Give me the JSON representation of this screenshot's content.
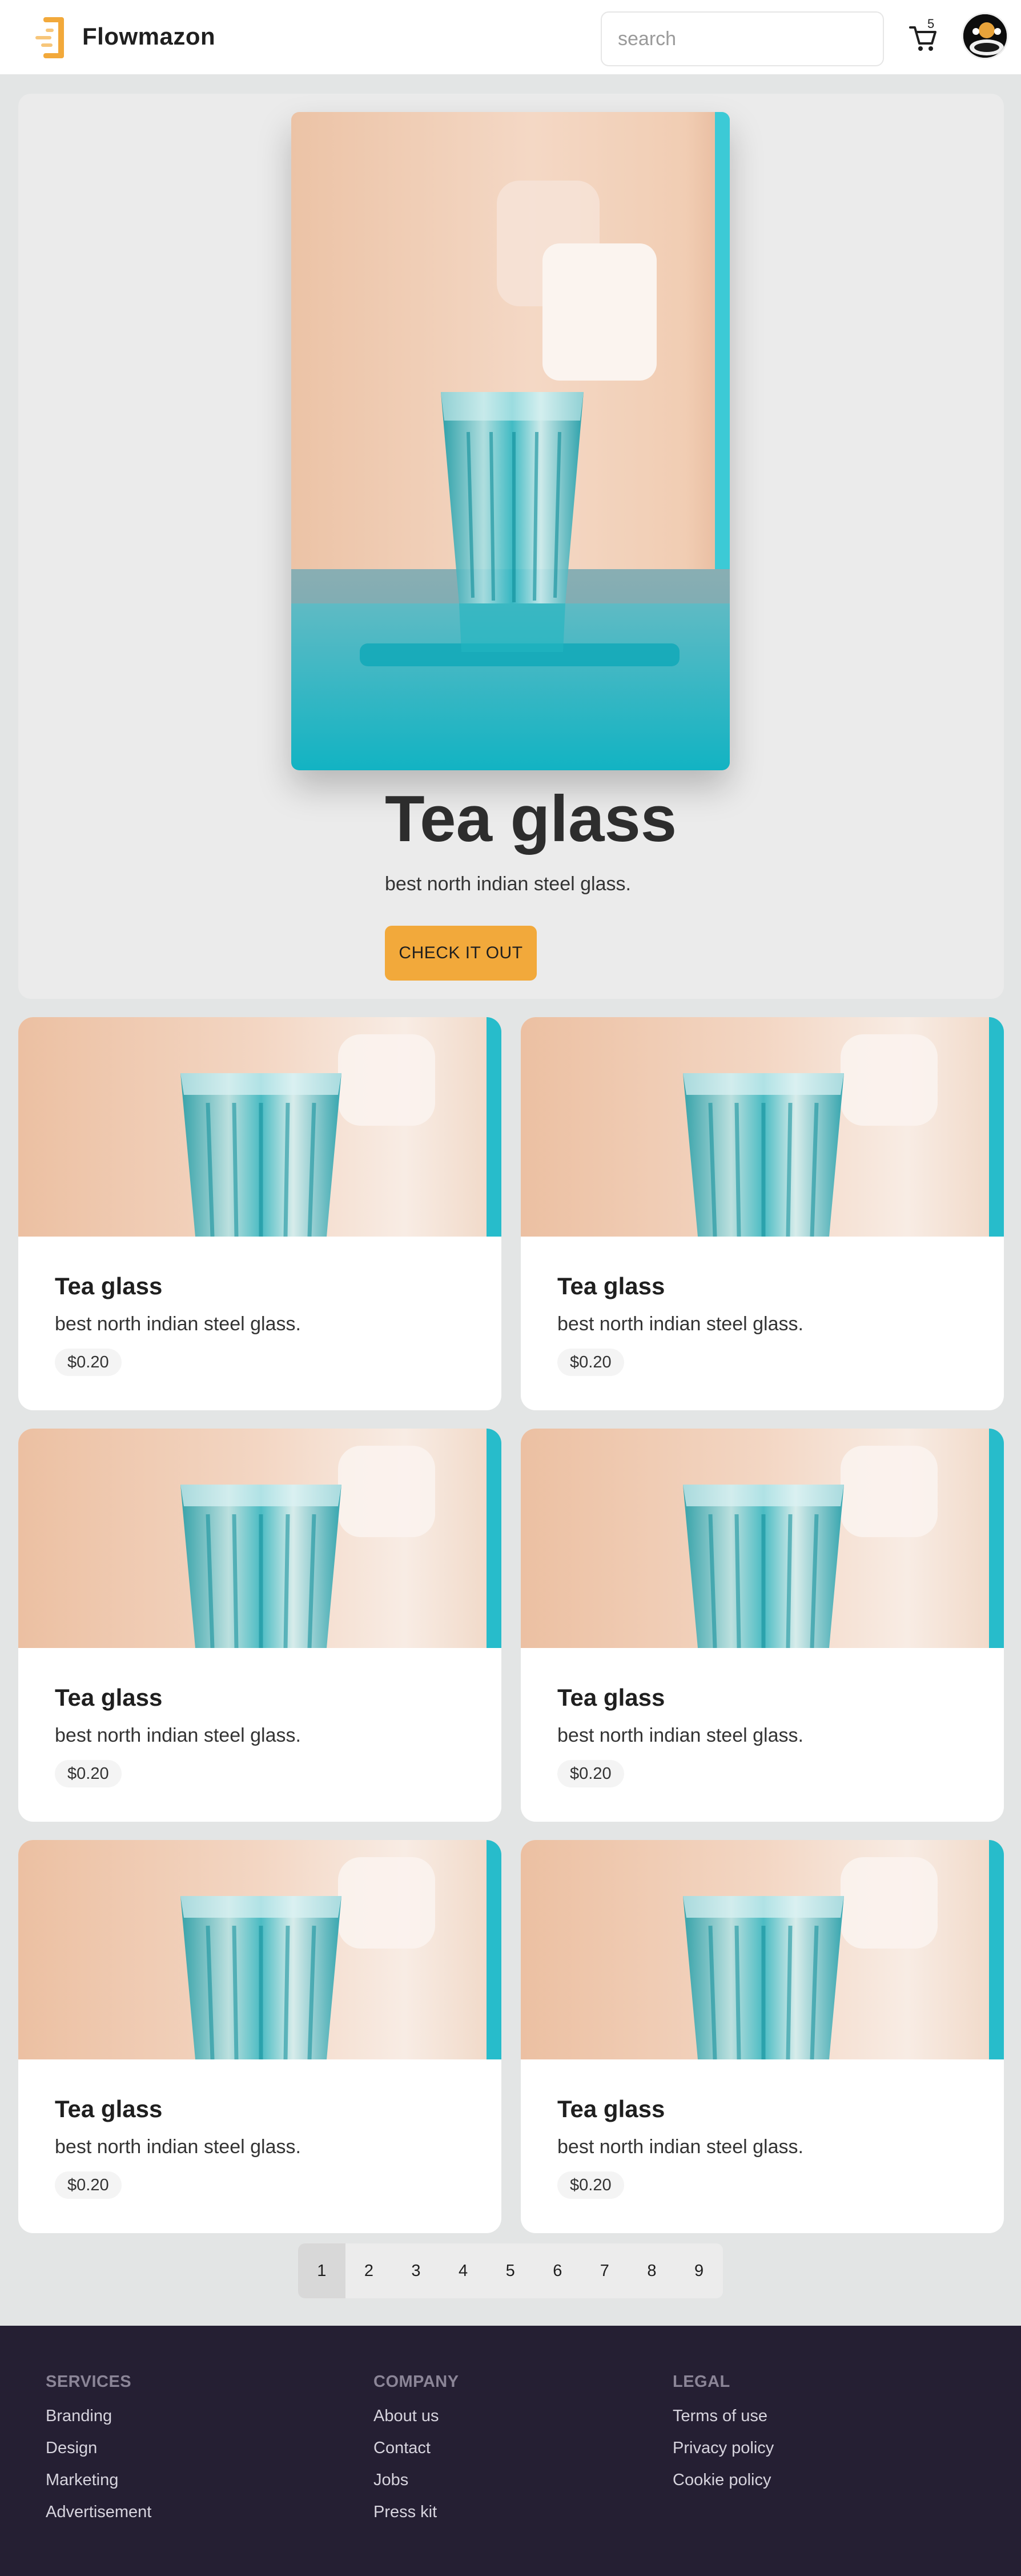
{
  "header": {
    "brand": "Flowmazon",
    "search_placeholder": "search",
    "cart_count": "5"
  },
  "hero": {
    "title": "Tea glass",
    "description": "best north indian steel glass.",
    "cta_label": "CHECK IT OUT"
  },
  "products": [
    {
      "title": "Tea glass",
      "description": "best north indian steel glass.",
      "price": "$0.20"
    },
    {
      "title": "Tea glass",
      "description": "best north indian steel glass.",
      "price": "$0.20"
    },
    {
      "title": "Tea glass",
      "description": "best north indian steel glass.",
      "price": "$0.20"
    },
    {
      "title": "Tea glass",
      "description": "best north indian steel glass.",
      "price": "$0.20"
    },
    {
      "title": "Tea glass",
      "description": "best north indian steel glass.",
      "price": "$0.20"
    },
    {
      "title": "Tea glass",
      "description": "best north indian steel glass.",
      "price": "$0.20"
    }
  ],
  "pagination": {
    "pages": [
      "1",
      "2",
      "3",
      "4",
      "5",
      "6",
      "7",
      "8",
      "9"
    ],
    "current": "1"
  },
  "footer": {
    "services": {
      "heading": "Services",
      "links": [
        "Branding",
        "Design",
        "Marketing",
        "Advertisement"
      ]
    },
    "company": {
      "heading": "Company",
      "links": [
        "About us",
        "Contact",
        "Jobs",
        "Press kit"
      ]
    },
    "legal": {
      "heading": "Legal",
      "links": [
        "Terms of use",
        "Privacy policy",
        "Cookie policy"
      ]
    }
  },
  "colors": {
    "accent": "#f2a93b",
    "footer_bg": "#251f33",
    "page_bg": "#e3e5e5",
    "glass_teal": "#1bb6c4"
  },
  "icons": [
    "logo-icon",
    "cart-icon",
    "avatar"
  ]
}
